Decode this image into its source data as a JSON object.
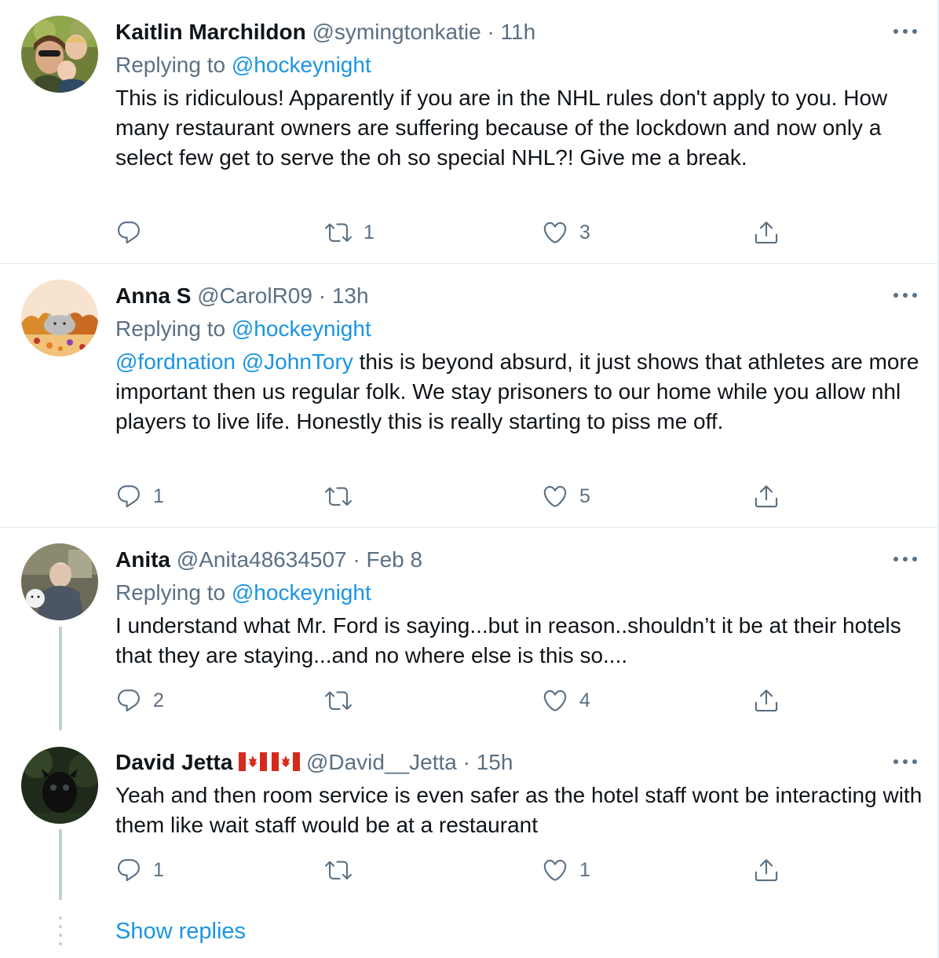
{
  "tweets": [
    {
      "name": "Kaitlin Marchildon",
      "handle": "@symingtonkatie",
      "dot": "·",
      "time": "11h",
      "replying_prefix": "Replying to",
      "replying_to": "@hockeynight",
      "text": "This is ridiculous! Apparently if you are in the NHL rules don't apply to you. How many restaurant owners are suffering because of the lockdown and now only a select few get to serve the oh so special NHL?! Give me a break.",
      "reply_count": "",
      "retweet_count": "1",
      "like_count": "3"
    },
    {
      "name": "Anna S",
      "handle": "@CarolR09",
      "dot": "·",
      "time": "13h",
      "replying_prefix": "Replying to",
      "replying_to": "@hockeynight",
      "mention1": "@fordnation",
      "mention2": "@JohnTory",
      "text": " this is beyond absurd, it just shows that athletes are more important then us regular folk. We stay prisoners to our home while you allow nhl players to live life. Honestly this is really starting to piss me off.",
      "reply_count": "1",
      "retweet_count": "",
      "like_count": "5"
    },
    {
      "name": "Anita",
      "handle": "@Anita48634507",
      "dot": "·",
      "time": "Feb 8",
      "replying_prefix": "Replying to",
      "replying_to": "@hockeynight",
      "text": "I understand what Mr. Ford is saying...but in reason..shouldn’t it be at their hotels that they are staying...and no where else is this so....",
      "reply_count": "2",
      "retweet_count": "",
      "like_count": "4"
    },
    {
      "name": "David Jetta",
      "handle": "@David__Jetta",
      "dot": "·",
      "time": "15h",
      "text": "Yeah and then room service is even safer as the hotel staff wont be interacting with them like wait staff would be at a restaurant",
      "reply_count": "1",
      "retweet_count": "",
      "like_count": "1"
    }
  ],
  "show_replies": "Show replies",
  "icons": [
    "more-icon",
    "reply-icon",
    "retweet-icon",
    "like-icon",
    "share-icon",
    "canada-flag-icon"
  ],
  "colors": {
    "link": "#1b95e0",
    "secondary": "#5b7083",
    "text": "#0f1419",
    "separator": "#e1e8ed"
  }
}
